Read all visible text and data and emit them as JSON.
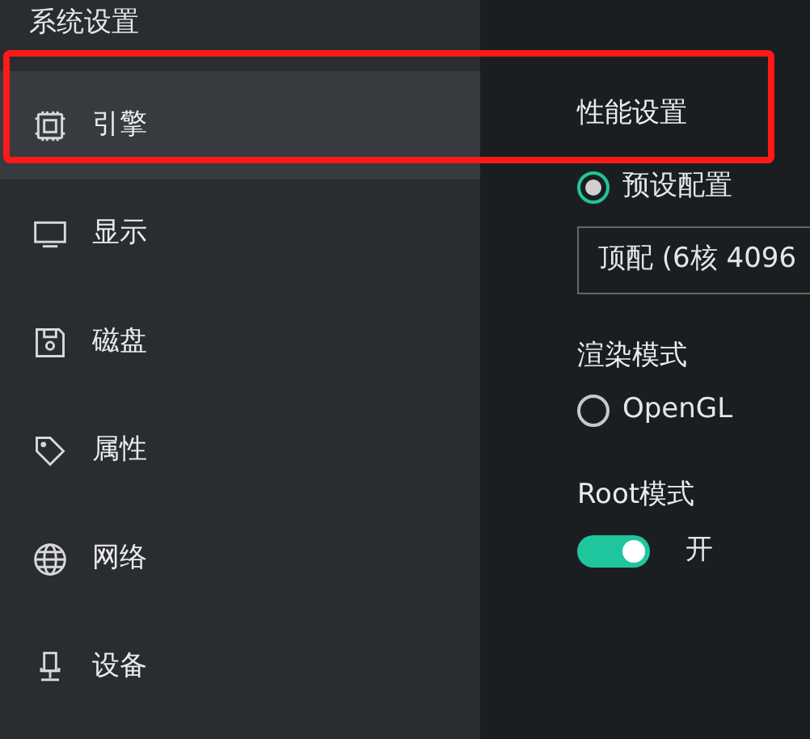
{
  "sidebar": {
    "title": "系统设置",
    "items": [
      {
        "label": "引擎",
        "selected": true,
        "highlighted": true
      },
      {
        "label": "显示",
        "selected": false,
        "highlighted": false
      },
      {
        "label": "磁盘",
        "selected": false,
        "highlighted": false
      },
      {
        "label": "属性",
        "selected": false,
        "highlighted": false
      },
      {
        "label": "网络",
        "selected": false,
        "highlighted": false
      },
      {
        "label": "设备",
        "selected": false,
        "highlighted": false
      }
    ]
  },
  "content": {
    "sections": [
      {
        "title": "性能设置",
        "kind": "radio",
        "options": [
          {
            "label": "预设配置",
            "selected": true
          }
        ],
        "dropdown": {
          "value": "顶配 (6核 4096"
        }
      },
      {
        "title": "渲染模式",
        "kind": "radio",
        "options": [
          {
            "label": "OpenGL",
            "selected": false
          }
        ]
      },
      {
        "title": "Root模式",
        "kind": "toggle",
        "toggle": {
          "on": true,
          "label": "开"
        }
      }
    ]
  }
}
